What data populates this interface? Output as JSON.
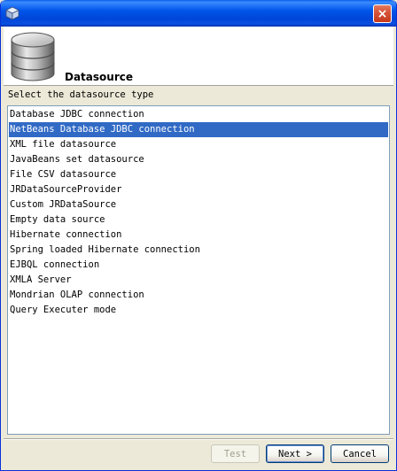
{
  "window": {
    "app_icon": "cube-icon",
    "close_icon": "close-icon",
    "close_glyph": "×"
  },
  "header": {
    "icon": "database-icon",
    "title": "Datasource"
  },
  "prompt": "Select the datasource type",
  "datasource_list": {
    "selected_index": 1,
    "items": [
      "Database JDBC connection",
      "NetBeans Database JDBC connection",
      "XML file datasource",
      "JavaBeans set datasource",
      "File CSV datasource",
      "JRDataSourceProvider",
      "Custom JRDataSource",
      "Empty data source",
      "Hibernate connection",
      "Spring loaded Hibernate connection",
      "EJBQL connection",
      "XMLA Server",
      "Mondrian OLAP connection",
      "Query Executer mode"
    ]
  },
  "buttons": {
    "test": "Test",
    "next": "Next >",
    "cancel": "Cancel"
  },
  "colors": {
    "selection": "#316ac5",
    "titlebar": "#0055ea",
    "window_bg": "#ece9d8"
  }
}
